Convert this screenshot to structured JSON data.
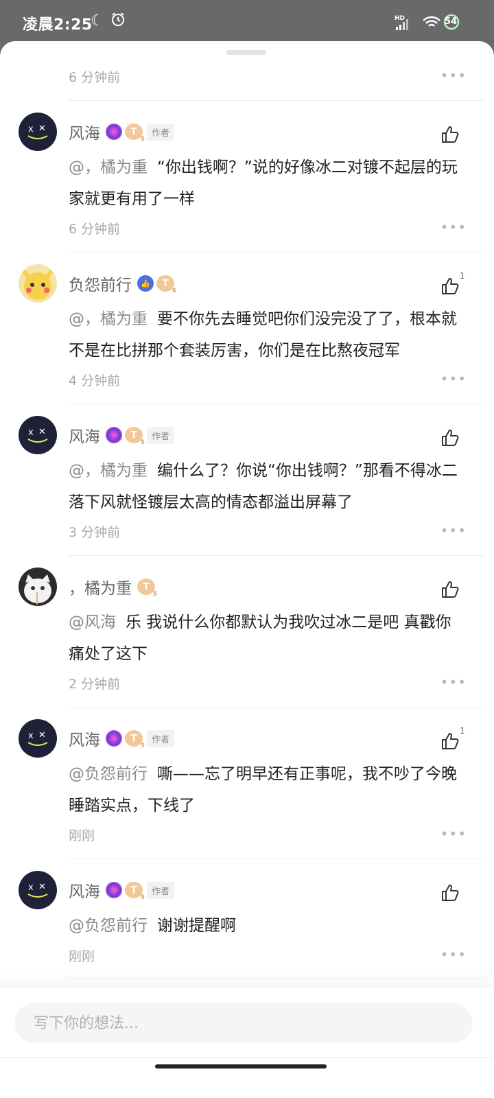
{
  "status_bar": {
    "time": "凌晨2:25",
    "network": "HD",
    "wifi_label": "6",
    "battery": "54"
  },
  "first_comment_time": "6 分钟前",
  "comments": [
    {
      "username": "风海",
      "author_tag": "作者",
      "mention": "@，橘为重",
      "text": "“你出钱啊？”说的好像冰二对镀不起层的玩家就更有用了一样",
      "time": "6 分钟前",
      "likes": ""
    },
    {
      "username": "负怨前行",
      "author_tag": "",
      "mention": "@，橘为重",
      "text": "要不你先去睡觉吧你们没完没了了，根本就不是在比拼那个套装厉害，你们是在比熬夜冠军",
      "time": "4 分钟前",
      "likes": "1"
    },
    {
      "username": "风海",
      "author_tag": "作者",
      "mention": "@，橘为重",
      "text": "编什么了？你说“你出钱啊？”那看不得冰二落下风就怪镀层太高的情态都溢出屏幕了",
      "time": "3 分钟前",
      "likes": ""
    },
    {
      "username": "，橘为重",
      "author_tag": "",
      "mention": "@风海",
      "text": "乐 我说什么你都默认为我吹过冰二是吧 真戳你痛处了这下",
      "time": "2 分钟前",
      "likes": ""
    },
    {
      "username": "风海",
      "author_tag": "作者",
      "mention": "@负怨前行",
      "text": "嘶——忘了明早还有正事呢，我不吵了今晚睡踏实点，下线了",
      "time": "刚刚",
      "likes": "1"
    },
    {
      "username": "风海",
      "author_tag": "作者",
      "mention": "@负怨前行",
      "text": "谢谢提醒啊",
      "time": "刚刚",
      "likes": ""
    }
  ],
  "input": {
    "placeholder": "写下你的想法..."
  },
  "icons": {
    "like": "thumbs-up-icon",
    "more": "more-dots-icon",
    "level": "T5"
  },
  "colors": {
    "text": "#222222",
    "secondary": "#a8a8a8",
    "avatar_dark": "#1f2139"
  }
}
